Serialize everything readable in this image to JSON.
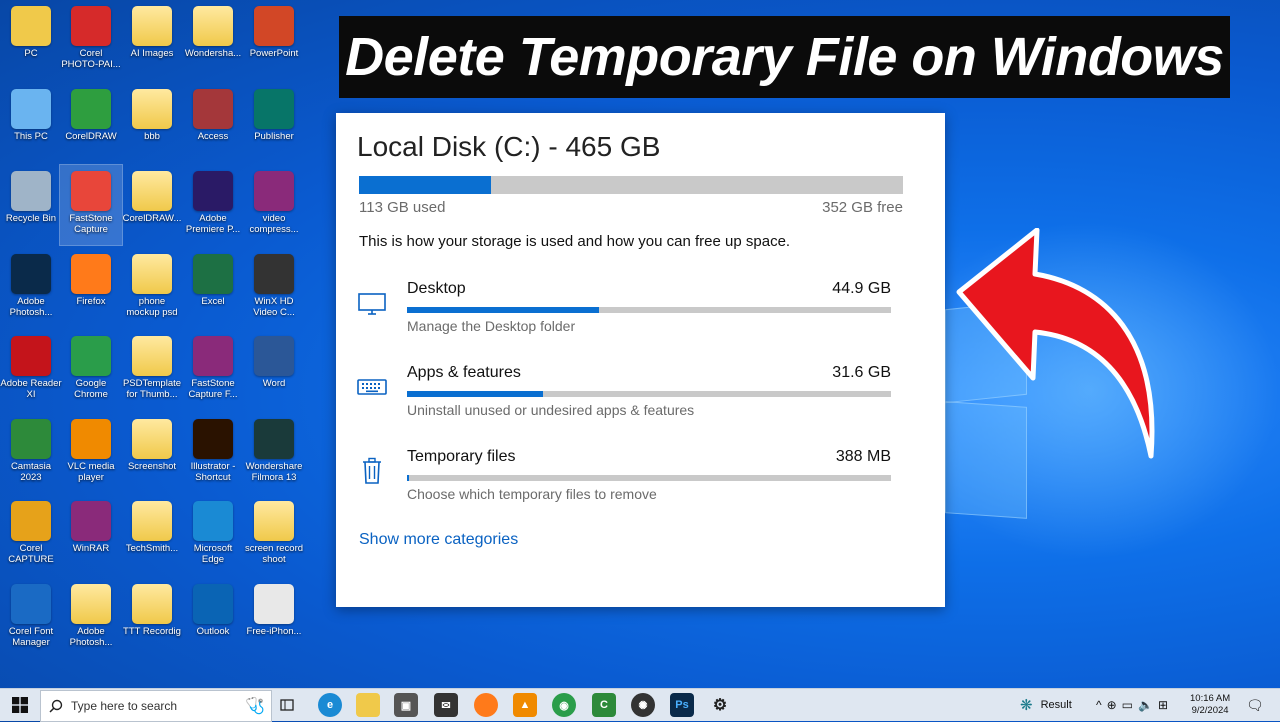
{
  "banner": {
    "title": "Delete Temporary File on Windows"
  },
  "desktop_icons": [
    {
      "label": "PC",
      "icon": "user-folder-icon",
      "color": "#f0c94a"
    },
    {
      "label": "Corel PHOTO-PAI...",
      "icon": "corel-photopaint-icon",
      "color": "#d62a2a"
    },
    {
      "label": "AI Images",
      "icon": "folder-icon",
      "color": "#f0c94a"
    },
    {
      "label": "Wondersha...",
      "icon": "folder-icon",
      "color": "#f0c94a"
    },
    {
      "label": "PowerPoint",
      "icon": "powerpoint-icon",
      "color": "#d24726"
    },
    {
      "label": "This PC",
      "icon": "computer-icon",
      "color": "#6ab4f0"
    },
    {
      "label": "CorelDRAW",
      "icon": "coreldraw-icon",
      "color": "#2e9e3f"
    },
    {
      "label": "bbb",
      "icon": "folder-icon",
      "color": "#f0c94a"
    },
    {
      "label": "Access",
      "icon": "access-icon",
      "color": "#a4373a"
    },
    {
      "label": "Publisher",
      "icon": "publisher-icon",
      "color": "#077568"
    },
    {
      "label": "Recycle Bin",
      "icon": "recycle-bin-icon",
      "color": "#9fb4c8"
    },
    {
      "label": "FastStone Capture",
      "icon": "faststone-capture-icon",
      "color": "#e8463a"
    },
    {
      "label": "CorelDRAW...",
      "icon": "folder-icon",
      "color": "#f0c94a"
    },
    {
      "label": "Adobe Premiere P...",
      "icon": "premiere-icon",
      "color": "#2a1a66"
    },
    {
      "label": "video compress...",
      "icon": "winrar-icon",
      "color": "#8a2a7a"
    },
    {
      "label": "Adobe Photosh...",
      "icon": "photoshop-icon",
      "color": "#0a2a4a"
    },
    {
      "label": "Firefox",
      "icon": "firefox-icon",
      "color": "#ff7a1a"
    },
    {
      "label": "phone mockup psd",
      "icon": "folder-icon",
      "color": "#f0c94a"
    },
    {
      "label": "Excel",
      "icon": "excel-icon",
      "color": "#1d7044"
    },
    {
      "label": "WinX HD Video C...",
      "icon": "film-reel-icon",
      "color": "#333333"
    },
    {
      "label": "Adobe Reader XI",
      "icon": "acrobat-icon",
      "color": "#c4141b"
    },
    {
      "label": "Google Chrome",
      "icon": "chrome-icon",
      "color": "#2a9d4a"
    },
    {
      "label": "PSDTemplate for Thumb...",
      "icon": "folder-icon",
      "color": "#f0c94a"
    },
    {
      "label": "FastStone Capture F...",
      "icon": "winrar-icon",
      "color": "#8a2a7a"
    },
    {
      "label": "Word",
      "icon": "word-icon",
      "color": "#2b5797"
    },
    {
      "label": "Camtasia 2023",
      "icon": "camtasia-icon",
      "color": "#2d8a3a"
    },
    {
      "label": "VLC media player",
      "icon": "vlc-icon",
      "color": "#f08a00"
    },
    {
      "label": "Screenshot",
      "icon": "folder-icon",
      "color": "#f0c94a"
    },
    {
      "label": "Illustrator - Shortcut",
      "icon": "illustrator-icon",
      "color": "#2a1200"
    },
    {
      "label": "Wondershare Filmora 13",
      "icon": "filmora-icon",
      "color": "#1a3a3a"
    },
    {
      "label": "Corel CAPTURE",
      "icon": "corel-capture-icon",
      "color": "#e6a21a"
    },
    {
      "label": "WinRAR",
      "icon": "winrar-icon",
      "color": "#8a2a7a"
    },
    {
      "label": "TechSmith...",
      "icon": "folder-icon",
      "color": "#f0c94a"
    },
    {
      "label": "Microsoft Edge",
      "icon": "edge-icon",
      "color": "#1a8ad4"
    },
    {
      "label": "screen record shoot",
      "icon": "folder-icon",
      "color": "#f0c94a"
    },
    {
      "label": "Corel Font Manager",
      "icon": "corel-font-icon",
      "color": "#1a6ac4"
    },
    {
      "label": "Adobe Photosh...",
      "icon": "folder-icon",
      "color": "#f0c94a"
    },
    {
      "label": "TTT Recordig",
      "icon": "folder-icon",
      "color": "#f0c94a"
    },
    {
      "label": "Outlook",
      "icon": "outlook-icon",
      "color": "#0a64b4"
    },
    {
      "label": "Free-iPhon...",
      "icon": "image-file-icon",
      "color": "#e8e8e8"
    }
  ],
  "storage": {
    "title": "Local Disk (C:) - 465 GB",
    "used_label": "113 GB used",
    "free_label": "352 GB free",
    "used_fraction": 0.243,
    "description": "This is how your storage is used and how you can free up space.",
    "categories": [
      {
        "name": "Desktop",
        "size": "44.9 GB",
        "subtitle": "Manage the Desktop folder",
        "fraction": 0.397,
        "icon": "monitor-icon"
      },
      {
        "name": "Apps & features",
        "size": "31.6 GB",
        "subtitle": "Uninstall unused or undesired apps & features",
        "fraction": 0.28,
        "icon": "keyboard-icon"
      },
      {
        "name": "Temporary files",
        "size": "388 MB",
        "subtitle": "Choose which temporary files to remove",
        "fraction": 0.003,
        "icon": "trash-icon"
      }
    ],
    "show_more": "Show more categories"
  },
  "taskbar": {
    "search_placeholder": "Type here to search",
    "weather": "Result",
    "time": "10:16 AM",
    "date": "9/2/2024"
  },
  "colors": {
    "accent": "#0a6fd1",
    "arrow": "#e8161e",
    "banner_bg": "#0b0b0b"
  }
}
